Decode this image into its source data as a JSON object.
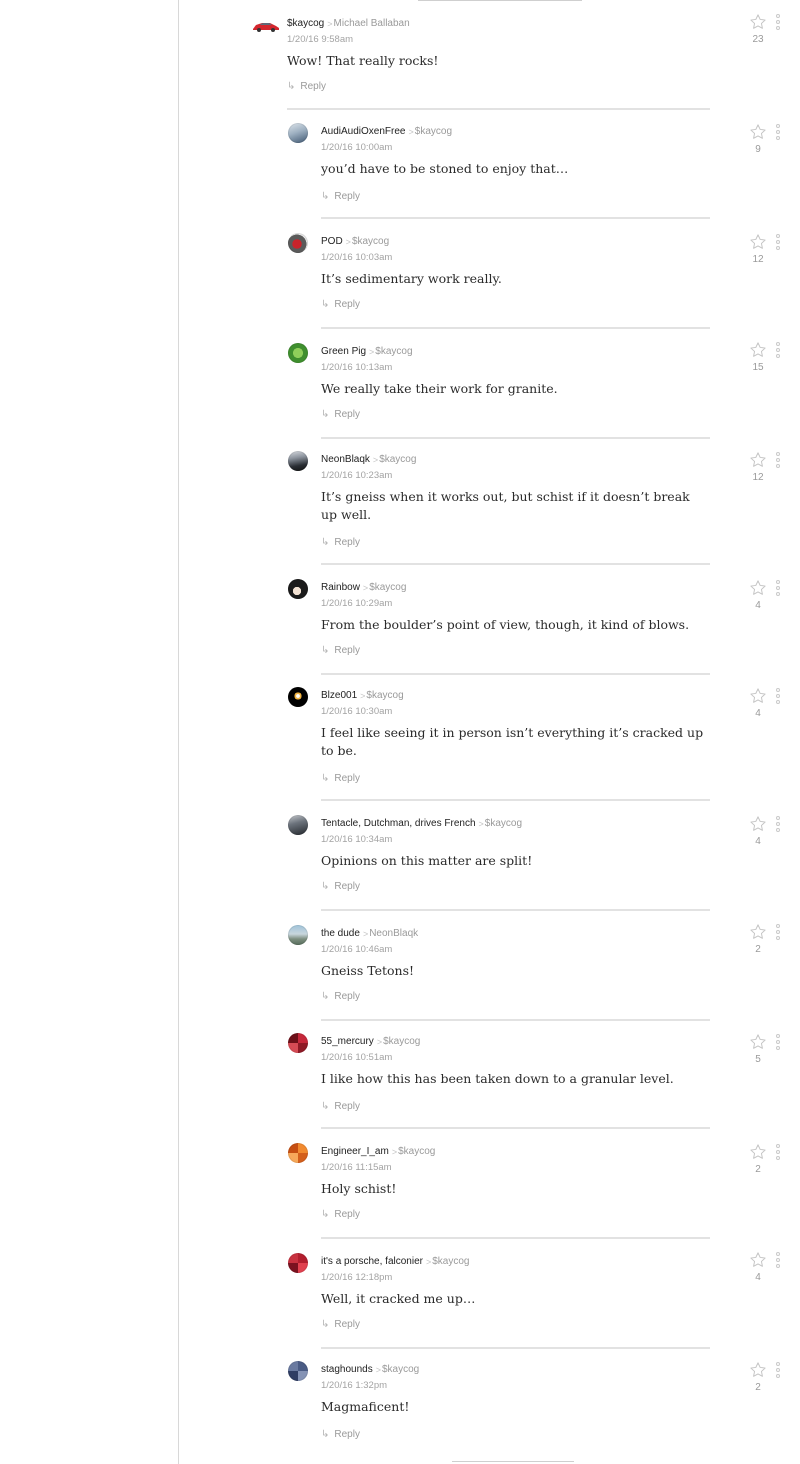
{
  "comments": [
    {
      "author": "$kaycog",
      "replying_to": "Michael Ballaban",
      "timestamp": "1/20/16 9:58am",
      "text": "Wow! That really rocks!",
      "likes": "23",
      "avatar": "red-car-avatar",
      "reply_label": "Reply"
    },
    {
      "author": "AudiAudiOxenFree",
      "replying_to": "$kaycog",
      "timestamp": "1/20/16 10:00am",
      "text": "you’d have to be stoned to enjoy that…",
      "likes": "9",
      "avatar": "car-photo-avatar",
      "reply_label": "Reply"
    },
    {
      "author": "POD",
      "replying_to": "$kaycog",
      "timestamp": "1/20/16 10:03am",
      "text": "It’s sedimentary work really.",
      "likes": "12",
      "avatar": "red-car-avatar",
      "reply_label": "Reply"
    },
    {
      "author": "Green Pig",
      "replying_to": "$kaycog",
      "timestamp": "1/20/16 10:13am",
      "text": "We really take their work for granite.",
      "likes": "15",
      "avatar": "green-pig-avatar",
      "reply_label": "Reply"
    },
    {
      "author": "NeonBlaqk",
      "replying_to": "$kaycog",
      "timestamp": "1/20/16 10:23am",
      "text": "It’s gneiss when it works out, but schist if it doesn’t break up well.",
      "likes": "12",
      "avatar": "dark-car-avatar",
      "reply_label": "Reply"
    },
    {
      "author": "Rainbow",
      "replying_to": "$kaycog",
      "timestamp": "1/20/16 10:29am",
      "text": "From the boulder’s point of view, though, it kind of blows.",
      "likes": "4",
      "avatar": "anime-avatar",
      "reply_label": "Reply"
    },
    {
      "author": "Blze001",
      "replying_to": "$kaycog",
      "timestamp": "1/20/16 10:30am",
      "text": "I feel like seeing it in person isn’t everything it’s cracked up to be.",
      "likes": "4",
      "avatar": "dark-flame-avatar",
      "reply_label": "Reply"
    },
    {
      "author": "Tentacle, Dutchman, drives French",
      "replying_to": "$kaycog",
      "timestamp": "1/20/16 10:34am",
      "text": "Opinions on this matter are split!",
      "likes": "4",
      "avatar": "gray-car-avatar",
      "reply_label": "Reply"
    },
    {
      "author": "the dude",
      "replying_to": "NeonBlaqk",
      "timestamp": "1/20/16 10:46am",
      "text": "Gneiss Tetons!",
      "likes": "2",
      "avatar": "landscape-avatar",
      "reply_label": "Reply"
    },
    {
      "author": "55_mercury",
      "replying_to": "$kaycog",
      "timestamp": "1/20/16 10:51am",
      "text": "I like how this has been taken down to a granular level.",
      "likes": "5",
      "avatar": "red-pattern-avatar",
      "reply_label": "Reply"
    },
    {
      "author": "Engineer_I_am",
      "replying_to": "$kaycog",
      "timestamp": "1/20/16 11:15am",
      "text": "Holy schist!",
      "likes": "2",
      "avatar": "orange-pattern-avatar",
      "reply_label": "Reply"
    },
    {
      "author": "it's a porsche, falconier",
      "replying_to": "$kaycog",
      "timestamp": "1/20/16 12:18pm",
      "text": "Well, it cracked me up…",
      "likes": "4",
      "avatar": "red-pattern-avatar",
      "reply_label": "Reply"
    },
    {
      "author": "staghounds",
      "replying_to": "$kaycog",
      "timestamp": "1/20/16 1:32pm",
      "text": "Magmaficent!",
      "likes": "2",
      "avatar": "blue-pattern-avatar",
      "reply_label": "Reply"
    }
  ],
  "colors": {
    "text": "#2a2a2a",
    "muted": "#9a9a9a",
    "divider": "#e2e2e2"
  }
}
